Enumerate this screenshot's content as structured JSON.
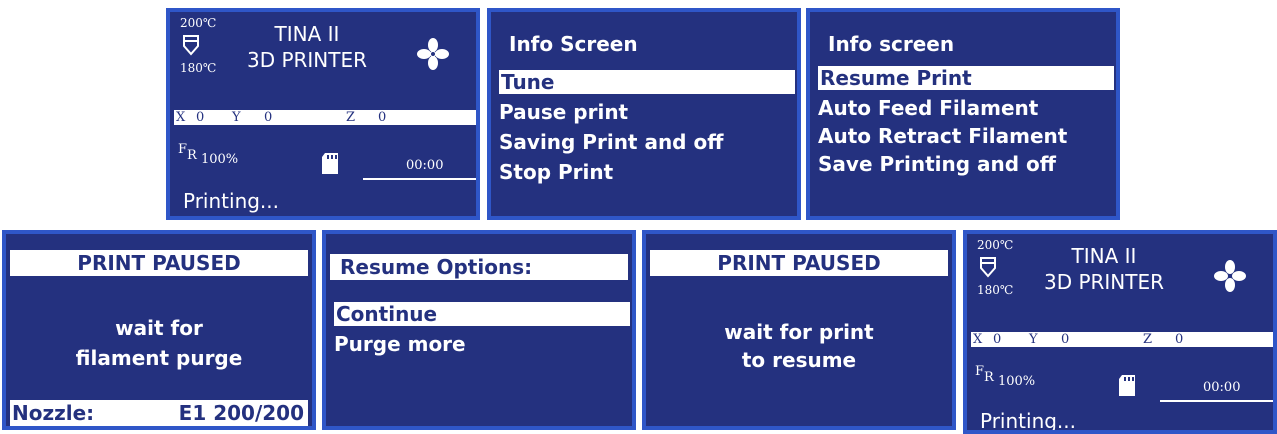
{
  "status_screen": {
    "temp_target": "200℃",
    "temp_current": "180℃",
    "title_line1": "TINA II",
    "title_line2": "3D PRINTER",
    "x_label": "X",
    "x_value": "0",
    "y_label": "Y",
    "y_value": "0",
    "z_label": "Z",
    "z_value": "0",
    "fr_label_f": "F",
    "fr_label_r": "R",
    "fr_value": "100%",
    "time": "00:00",
    "status": "Printing...",
    "icons": [
      "nozzle-icon",
      "fan-icon",
      "sd-card-icon"
    ]
  },
  "info_screen_1": {
    "title": "Info Screen",
    "items": [
      "Tune",
      "Pause print",
      "Saving Print and off",
      "Stop Print"
    ],
    "selected": "Tune"
  },
  "info_screen_2": {
    "title": "Info screen",
    "items": [
      "Resume Print",
      "Auto Feed Filament",
      "Auto Retract Filament",
      "Save Printing and off"
    ],
    "selected": "Resume Print"
  },
  "paused_purge": {
    "title": "PRINT PAUSED",
    "line1": "wait for",
    "line2": "filament purge",
    "nozzle_label": "Nozzle:",
    "nozzle_value": "E1 200/200"
  },
  "resume_options": {
    "title": "Resume Options:",
    "items": [
      "Continue",
      "Purge more"
    ],
    "selected": "Continue"
  },
  "paused_resume": {
    "title": "PRINT PAUSED",
    "line1": "wait for print",
    "line2": "to resume"
  },
  "colors": {
    "screen_bg": "#24317f",
    "screen_border": "#2f56c8",
    "text": "#ffffff",
    "highlight_bg": "#ffffff",
    "highlight_text": "#24317f"
  }
}
